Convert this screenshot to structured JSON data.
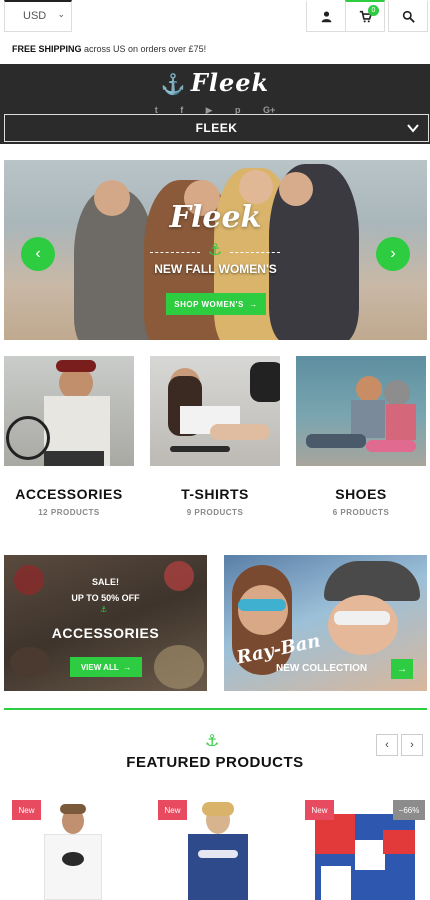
{
  "topbar": {
    "currency": "USD",
    "cart_count": "0",
    "shipping_bold": "FREE SHIPPING",
    "shipping_rest": " across US on orders over £75!"
  },
  "header": {
    "logo": "Fleek",
    "nav_label": "FLEEK",
    "socials": [
      "twitter-icon",
      "facebook-icon",
      "youtube-icon",
      "pinterest-icon",
      "google-plus-icon"
    ]
  },
  "hero": {
    "script_title": "Fleek",
    "subtitle": "NEW FALL WOMEN'S",
    "button_label": "SHOP WOMEN'S"
  },
  "categories": [
    {
      "title": "ACCESSORIES",
      "count": "12 PRODUCTS"
    },
    {
      "title": "T-SHIRTS",
      "count": "9 PRODUCTS"
    },
    {
      "title": "SHOES",
      "count": "6 PRODUCTS"
    }
  ],
  "promo_left": {
    "sale": "SALE!",
    "upto": "UP TO 50% OFF",
    "title": "ACCESSORIES",
    "button_label": "VIEW ALL"
  },
  "promo_right": {
    "brand": "Ray-Ban",
    "title": "NEW COLLECTION"
  },
  "featured": {
    "title": "FEATURED PRODUCTS",
    "products": [
      {
        "badge": "New"
      },
      {
        "badge": "New"
      },
      {
        "badge": "New",
        "discount": "−66%"
      }
    ]
  },
  "colors": {
    "accent": "#2ecc40",
    "dark": "#2b2b2b",
    "badge_new": "#e84a5f",
    "badge_sale": "#8c8c8c"
  }
}
